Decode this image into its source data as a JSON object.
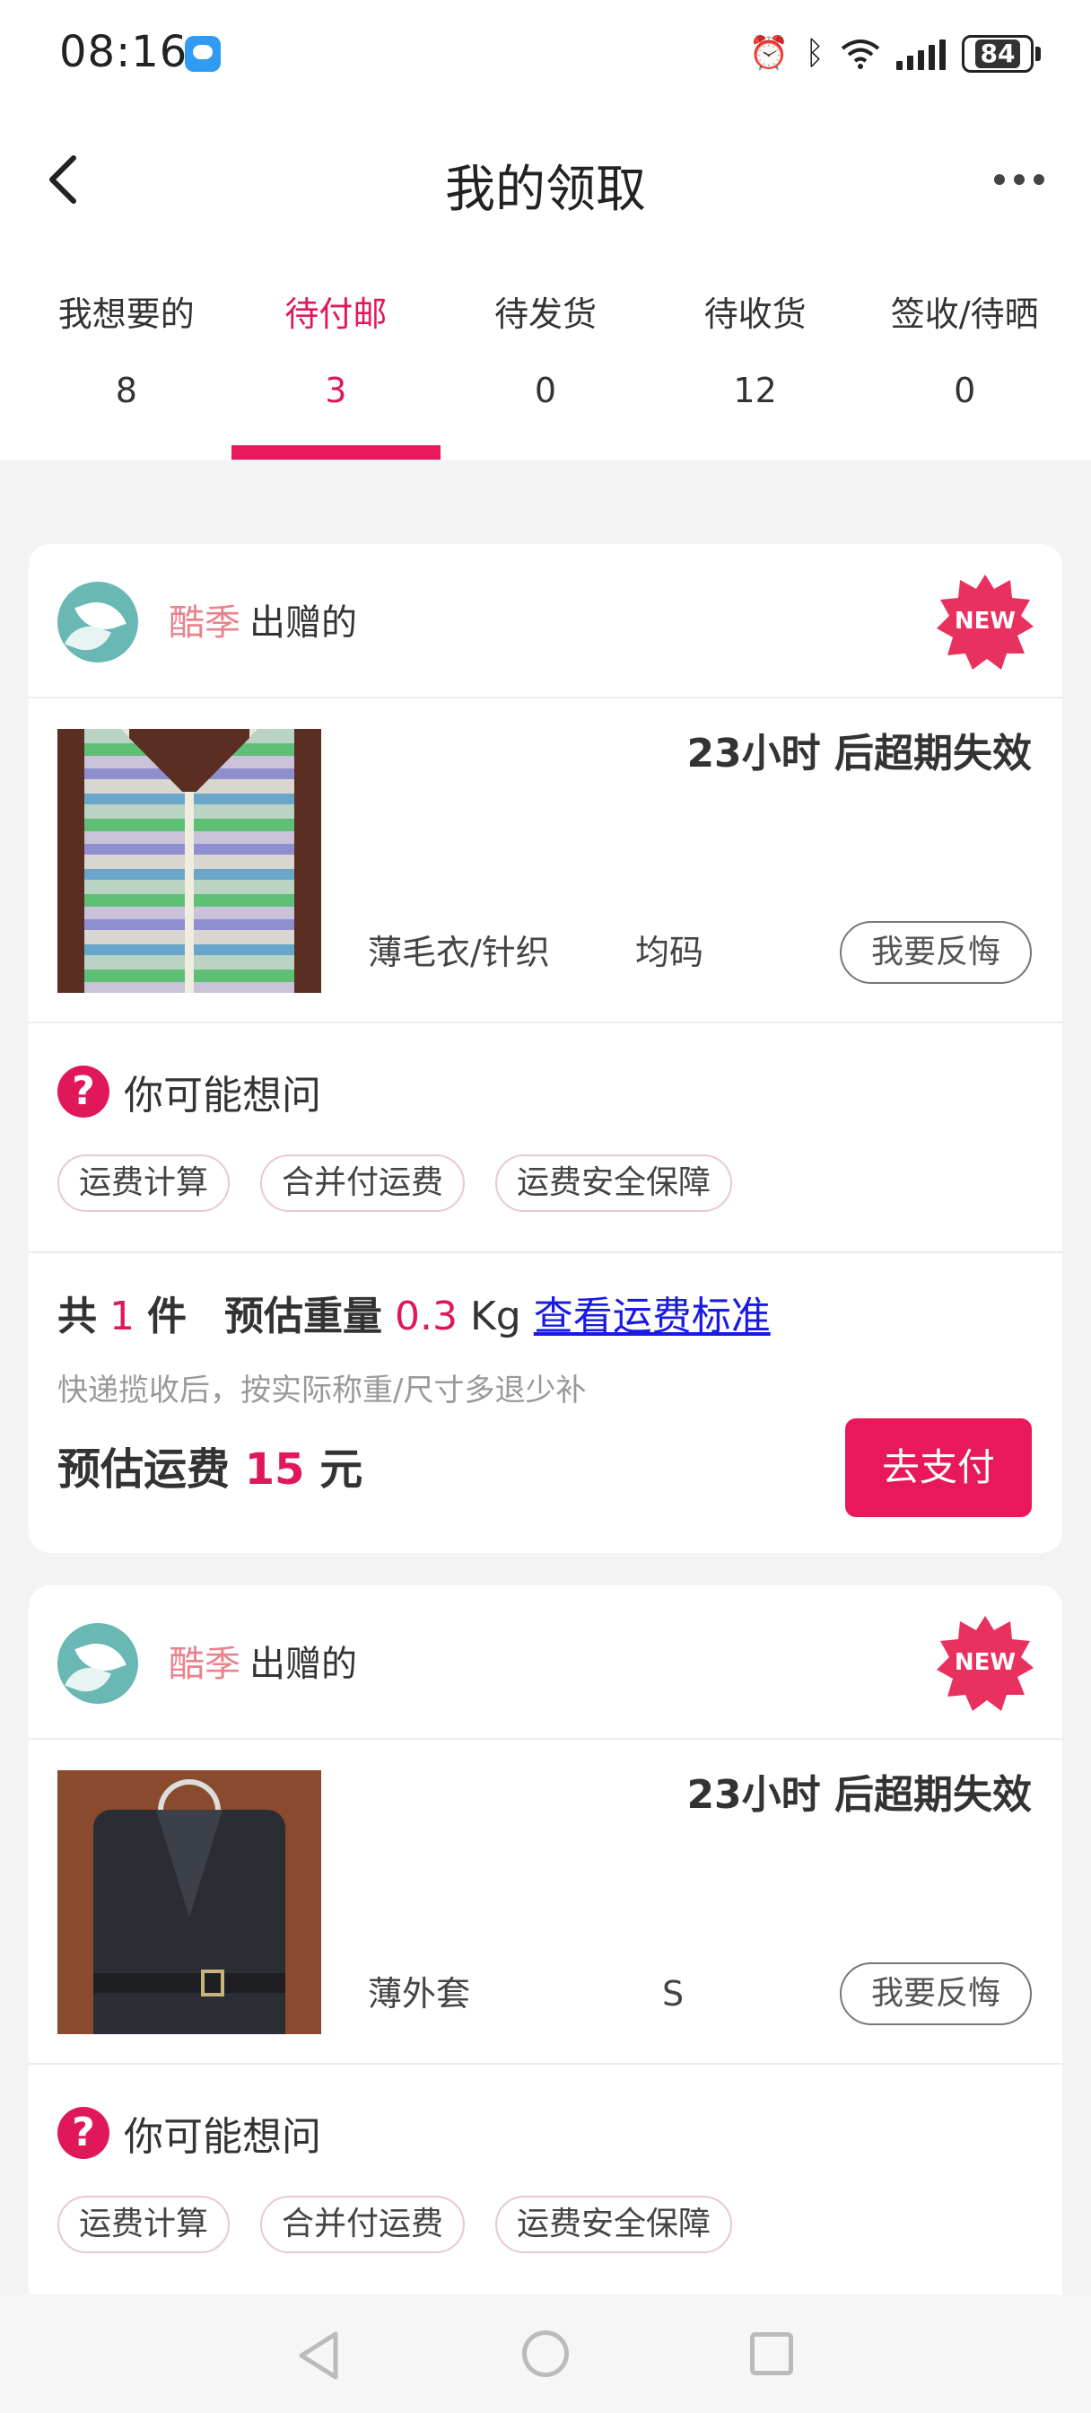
{
  "status": {
    "time": "08:16",
    "battery": "84"
  },
  "header": {
    "title": "我的领取"
  },
  "tabs": [
    {
      "label": "我想要的",
      "count": "8"
    },
    {
      "label": "待付邮",
      "count": "3"
    },
    {
      "label": "待发货",
      "count": "0"
    },
    {
      "label": "待收货",
      "count": "12"
    },
    {
      "label": "签收/待晒",
      "count": "0"
    }
  ],
  "cards": [
    {
      "giver": "酷季",
      "giver_suffix": "出赠的",
      "badge": "NEW",
      "expire": "23小时 后超期失效",
      "category": "薄毛衣/针织",
      "size": "均码",
      "regret_label": "我要反悔",
      "faq_title": "你可能想问",
      "chips": [
        "运费计算",
        "合并付运费",
        "运费安全保障"
      ],
      "summary": {
        "total_prefix": "共",
        "count": "1",
        "count_unit": "件",
        "weight_label": "预估重量",
        "weight": "0.3",
        "weight_unit": "Kg",
        "link": "查看运费标准",
        "note": "快递揽收后，按实际称重/尺寸多退少补",
        "fee_label": "预估运费",
        "fee": "15",
        "fee_unit": "元",
        "pay_label": "去支付"
      }
    },
    {
      "giver": "酷季",
      "giver_suffix": "出赠的",
      "badge": "NEW",
      "expire": "23小时 后超期失效",
      "category": "薄外套",
      "size": "S",
      "regret_label": "我要反悔",
      "faq_title": "你可能想问",
      "chips": [
        "运费计算",
        "合并付运费",
        "运费安全保障"
      ]
    }
  ],
  "colors": {
    "accent": "#e8185a",
    "giver": "#e8828c",
    "link": "#1a1ae0"
  }
}
